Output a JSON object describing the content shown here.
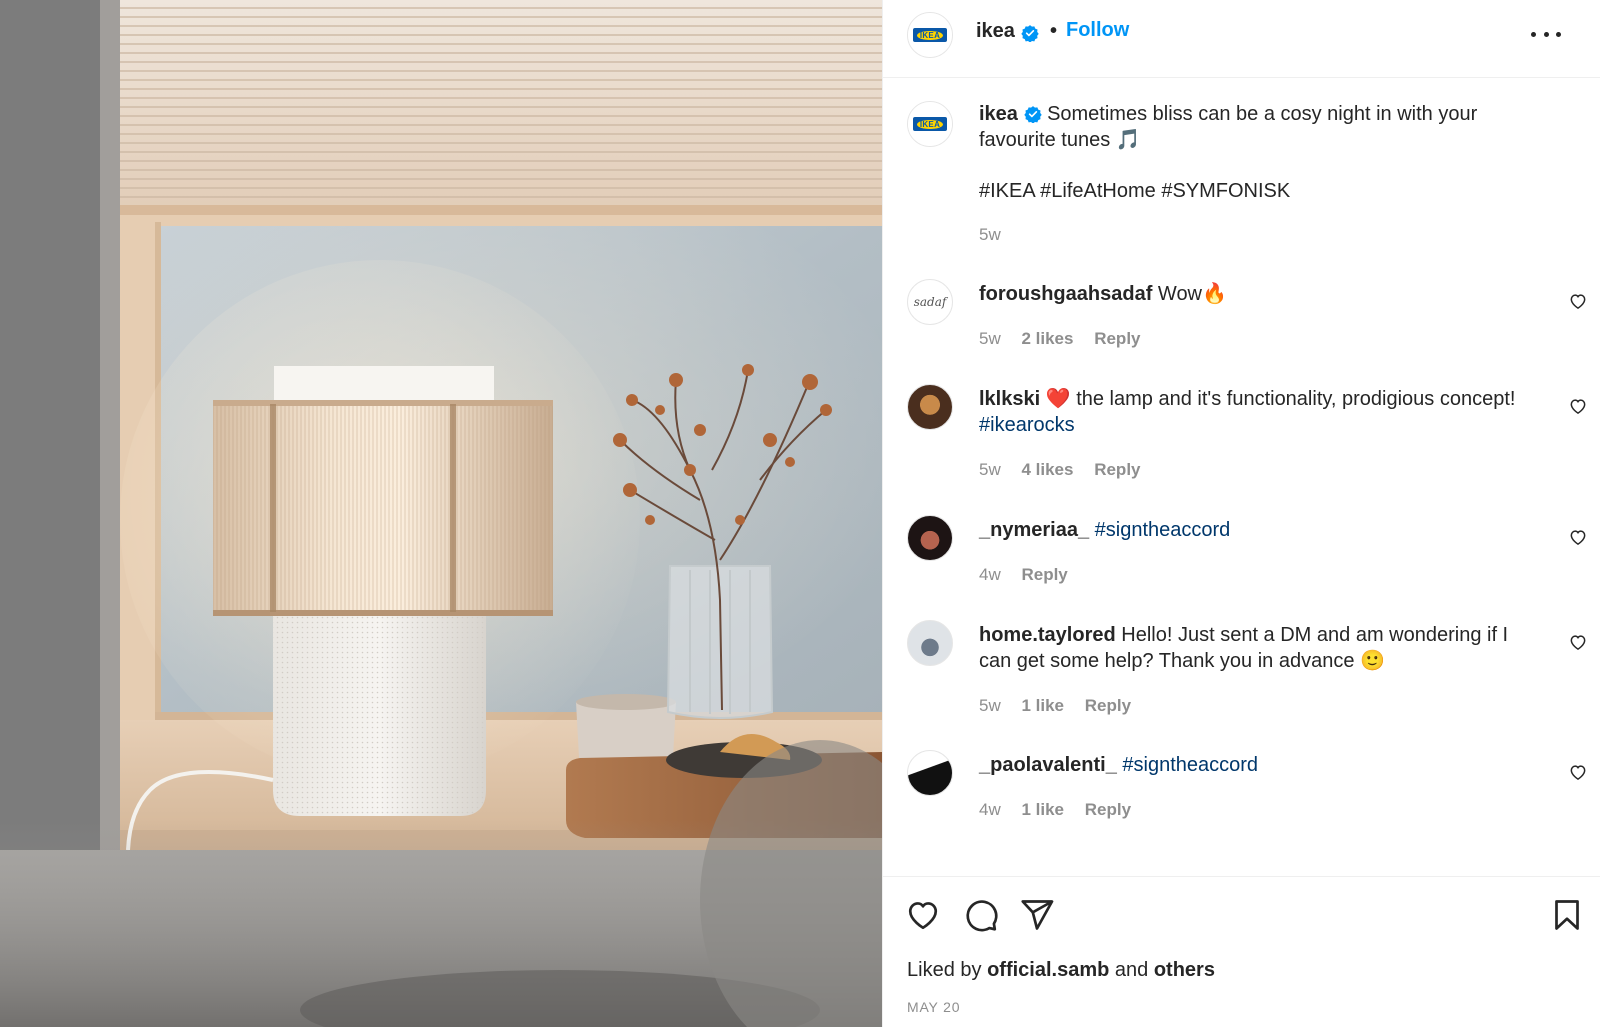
{
  "post": {
    "username": "ikea",
    "follow_label": "Follow",
    "separator": "•",
    "caption": "Sometimes bliss can be a cosy night in with your favourite tunes 🎵",
    "hashtags": "#IKEA #LifeAtHome #SYMFONISK",
    "time": "5w",
    "logo_text": "IKEA"
  },
  "comments": [
    {
      "username": "foroushgaahsadaf",
      "text": "Wow🔥",
      "hashtag": "",
      "time": "5w",
      "likes": "2 likes",
      "reply": "Reply",
      "avatar_text": "sadaf"
    },
    {
      "username": "lklkski",
      "text": "❤️ the lamp and it's functionality, prodigious concept!",
      "hashtag": "#ikearocks",
      "time": "5w",
      "likes": "4 likes",
      "reply": "Reply"
    },
    {
      "username": "_nymeriaa_",
      "text": "",
      "hashtag": "#signtheaccord",
      "time": "4w",
      "likes": "",
      "reply": "Reply"
    },
    {
      "username": "home.taylored",
      "text": "Hello! Just sent a DM and am wondering if I can get some help? Thank you in advance 🙂",
      "hashtag": "",
      "time": "5w",
      "likes": "1 like",
      "reply": "Reply"
    },
    {
      "username": "_paolavalenti_",
      "text": "",
      "hashtag": "#signtheaccord",
      "time": "4w",
      "likes": "1 like",
      "reply": "Reply"
    }
  ],
  "footer": {
    "liked_prefix": "Liked by",
    "liked_user": "official.samb",
    "liked_and": "and",
    "liked_others": "others",
    "date": "MAY 20"
  },
  "colors": {
    "follow": "#0095f6",
    "hashtag": "#00376b",
    "meta": "#8e8e8e",
    "verified": "#0095f6"
  },
  "icons": {
    "verified": "verified-badge-icon",
    "more": "more-options-icon",
    "like": "heart-icon",
    "comment": "comment-icon",
    "share": "send-icon",
    "save": "bookmark-icon"
  }
}
